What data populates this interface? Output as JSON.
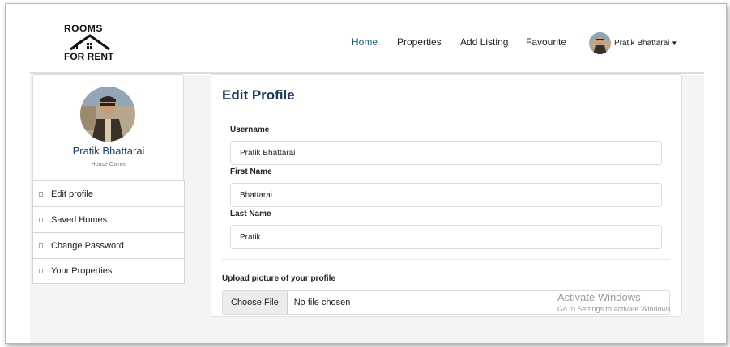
{
  "logo": {
    "line1": "ROOMS",
    "line2": "FOR RENT"
  },
  "nav": {
    "items": [
      {
        "label": "Home",
        "active": true
      },
      {
        "label": "Properties"
      },
      {
        "label": "Add Listing"
      },
      {
        "label": "Favourite"
      }
    ],
    "user_name": "Pratik Bhattarai",
    "caret_icon": "caret-down-icon"
  },
  "sidebar": {
    "name": "Pratik Bhattarai",
    "role": "House Owner",
    "items": [
      {
        "label": "Edit profile",
        "icon": "square-icon"
      },
      {
        "label": "Saved Homes",
        "icon": "square-icon"
      },
      {
        "label": "Change Password",
        "icon": "square-icon"
      },
      {
        "label": "Your Properties",
        "icon": "square-icon"
      }
    ]
  },
  "form": {
    "title": "Edit Profile",
    "username_label": "Username",
    "username_value": "Pratik Bhattarai",
    "first_name_label": "First Name",
    "first_name_value": "Bhattarai",
    "last_name_label": "Last Name",
    "last_name_value": "Pratik",
    "upload_label": "Upload picture of your profile",
    "choose_file_label": "Choose File",
    "file_status": "No file chosen"
  },
  "watermark": {
    "line1": "Activate Windows",
    "line2": "Go to Settings to activate Windows."
  },
  "colors": {
    "accent": "#1d3f63",
    "active_nav": "#1f5f7a",
    "background": "#f5f3f3"
  }
}
